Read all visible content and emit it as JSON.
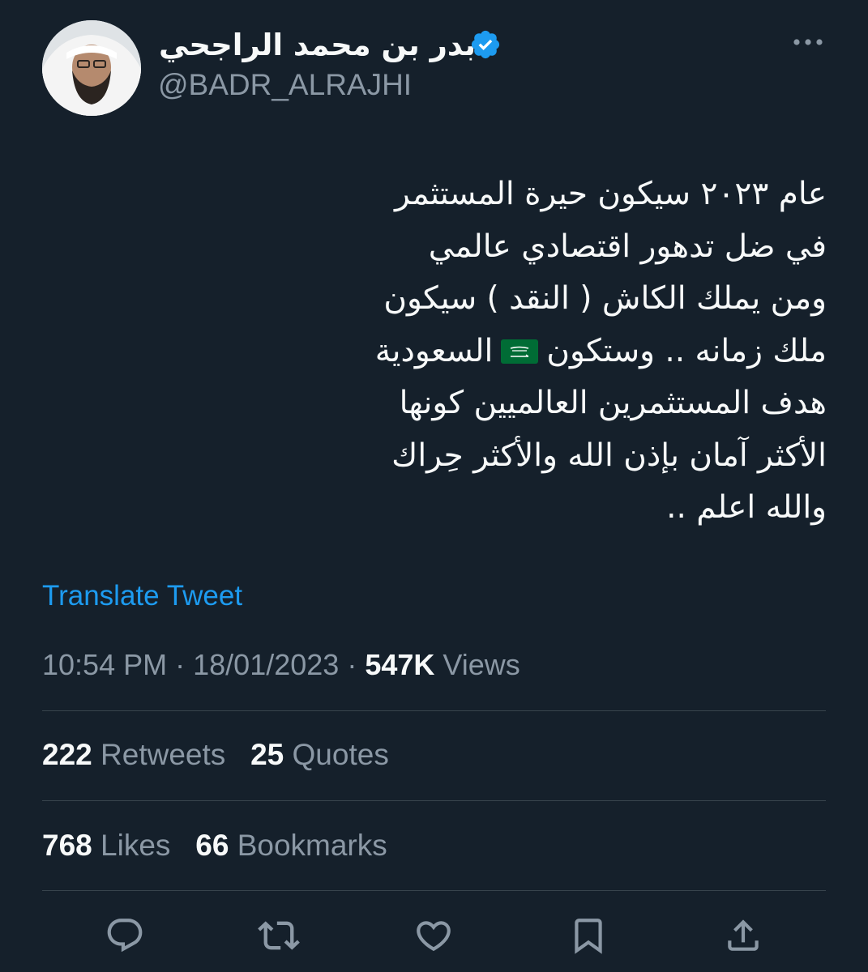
{
  "author": {
    "display_name": "بدر بن محمد الراجحي",
    "handle": "@BADR_ALRAJHI",
    "verified": true
  },
  "tweet": {
    "lines": [
      "عام ٢٠٢٣ سيكون حيرة المستثمر",
      "في ضل  تدهور  اقتصادي  عالمي",
      "ومن يملك الكاش ( النقد ) سيكون",
      "ملك زمانه .. وستكون",
      "السعودية",
      "هدف المستثمرين العالميين كونها",
      "الأكثر آمان بإذن الله والأكثر حِراك",
      "والله اعلم .."
    ],
    "flag_icon": "saudi-flag-emoji"
  },
  "translate_label": "Translate Tweet",
  "meta": {
    "time": "10:54 PM",
    "separator": "·",
    "date": "18/01/2023",
    "views_count": "547K",
    "views_label": "Views"
  },
  "stats": {
    "retweets_count": "222",
    "retweets_label": "Retweets",
    "quotes_count": "25",
    "quotes_label": "Quotes",
    "likes_count": "768",
    "likes_label": "Likes",
    "bookmarks_count": "66",
    "bookmarks_label": "Bookmarks"
  },
  "actions": [
    "reply-icon",
    "retweet-icon",
    "like-icon",
    "bookmark-icon",
    "share-icon"
  ],
  "colors": {
    "background": "#15202b",
    "text": "#f7f9f9",
    "secondary": "#8b98a5",
    "link": "#1d9bf0",
    "divider": "#38444d",
    "verified": "#1d9bf0"
  }
}
